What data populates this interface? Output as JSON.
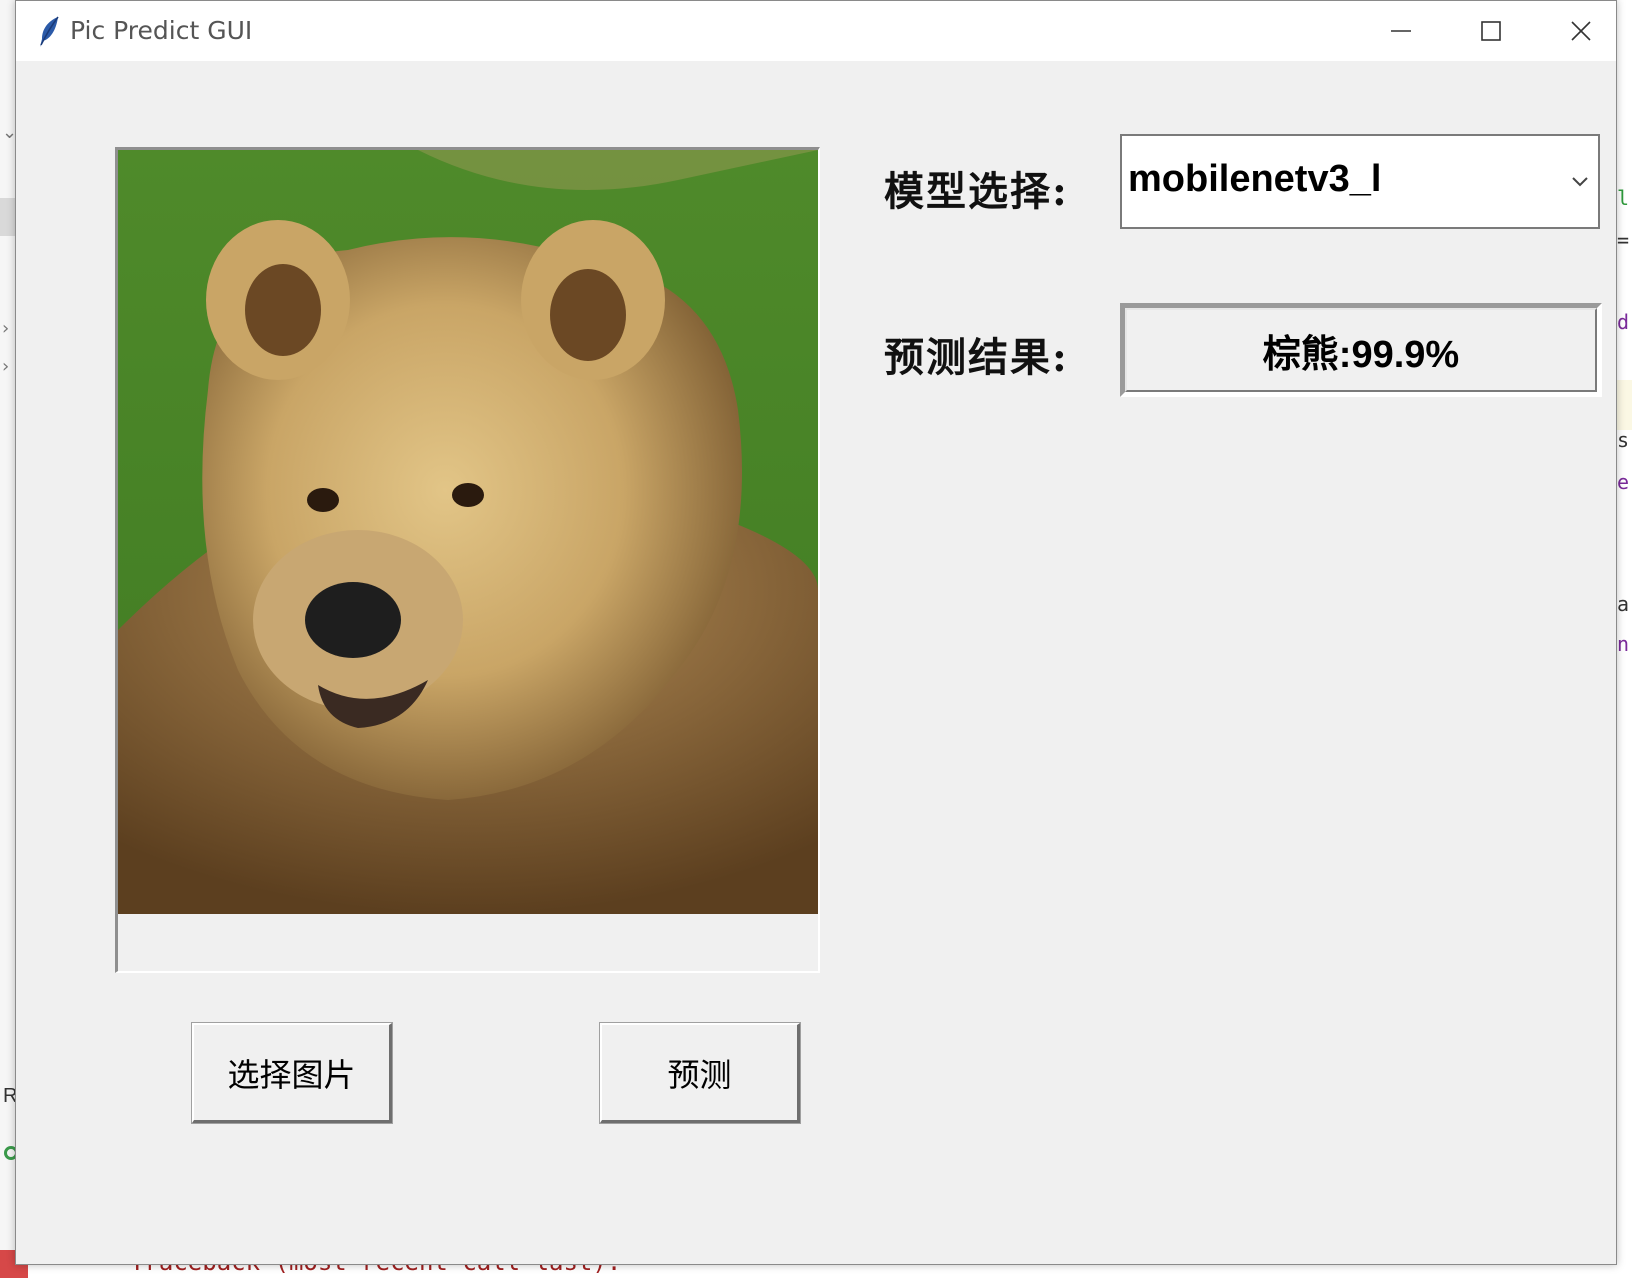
{
  "window": {
    "title": "Pic Predict GUI"
  },
  "form": {
    "model_label": "模型选择:",
    "model_selected": "mobilenetv3_l",
    "result_label": "预测结果:",
    "result_value": "棕熊:99.9%"
  },
  "buttons": {
    "select_image": "选择图片",
    "predict": "预测"
  },
  "background": {
    "console_text": "Traceback (most recent call last):",
    "top_fragment": "as"
  },
  "icons": {
    "app": "feather-icon",
    "minimize": "minimize-icon",
    "maximize": "maximize-icon",
    "close": "close-icon",
    "dropdown": "chevron-down-icon"
  }
}
